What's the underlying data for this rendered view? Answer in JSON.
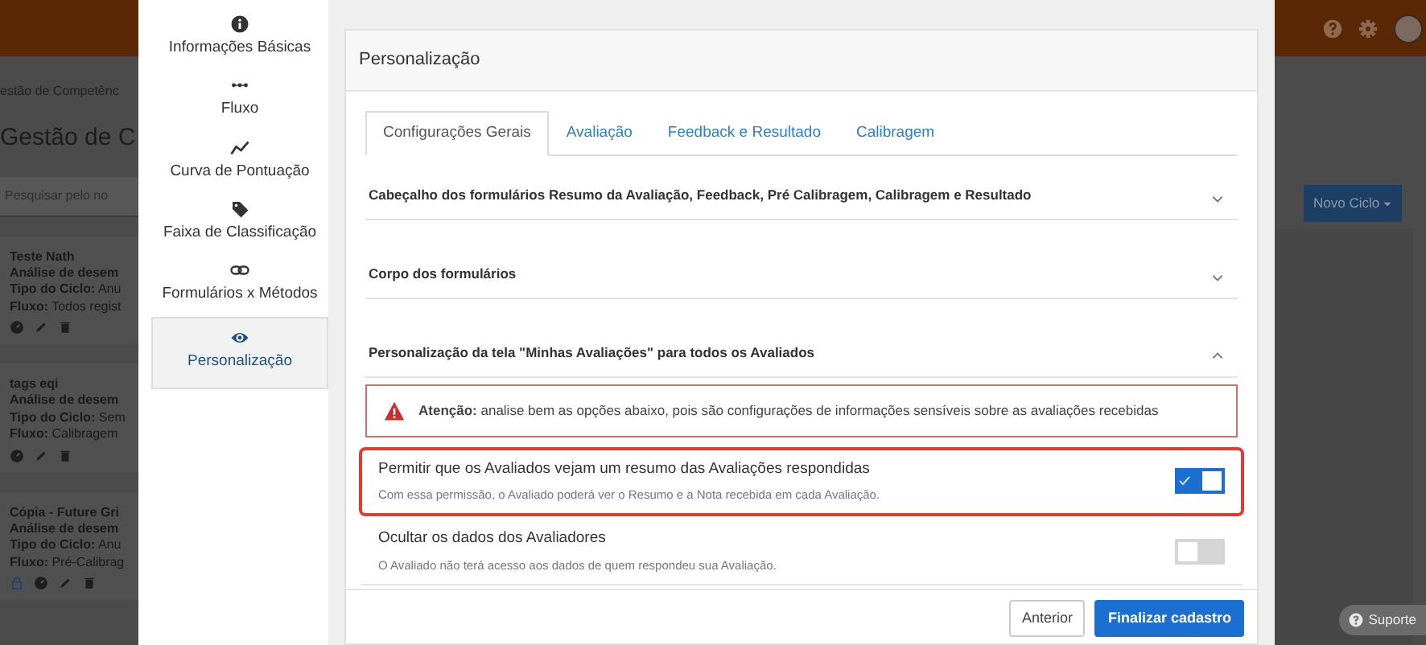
{
  "background_app": {
    "breadcrumb": "estão de Competênc",
    "title": "Gestão de C",
    "search": {
      "placeholder": "Pesquisar pelo no"
    },
    "cycles": [
      {
        "name": "Teste Nath",
        "subtitle": "Análise de desem",
        "type": "**Tipo do Ciclo:** Anu",
        "flow": "**Fluxo:** Todos regist",
        "locked": false
      },
      {
        "name": "tags eqi",
        "subtitle": "Análise de desem",
        "type": "**Tipo do Ciclo:** Sem",
        "flow": "**Fluxo:** Calibragem",
        "locked": false
      },
      {
        "name": "Cópia - Future Gri",
        "subtitle": "Análise de desem",
        "type": "**Tipo do Ciclo:** Anu",
        "flow": "**Fluxo:** Pré-Calibrag",
        "locked": true
      }
    ],
    "new_button": "Novo Ciclo",
    "support_button": "Suporte"
  },
  "modal": {
    "steps": [
      {
        "label": "Informações Básicas",
        "selected": false
      },
      {
        "label": "Fluxo",
        "selected": false
      },
      {
        "label": "Curva de Pontuação",
        "selected": false
      },
      {
        "label": "Faixa de Classificação",
        "selected": false
      },
      {
        "label": "Formulários x Métodos",
        "selected": false
      },
      {
        "label": "Personalização",
        "selected": true
      }
    ],
    "panel_title": "Personalização",
    "tabs": [
      {
        "label": "Configurações Gerais",
        "selected": true
      },
      {
        "label": "Avaliação",
        "selected": false
      },
      {
        "label": "Feedback e Resultado",
        "selected": false
      },
      {
        "label": "Calibragem",
        "selected": false
      }
    ],
    "sections": [
      {
        "title": "Cabeçalho dos formulários Resumo da Avaliação, Feedback, Pré Calibragem, Calibragem e Resultado",
        "expanded": false
      },
      {
        "title": "Corpo dos formulários",
        "expanded": false
      },
      {
        "title": "Personalização da tela \"Minhas Avaliações\" para todos os Avaliados",
        "expanded": true
      }
    ],
    "alert": "**Atenção:** analise bem as opções abaixo, pois são configurações de informações sensíveis sobre as avaliações recebidas",
    "options": [
      {
        "label": "Permitir que os Avaliados vejam um resumo das Avaliações respondidas",
        "description": "Com essa permissão, o Avaliado poderá ver o Resumo e a Nota recebida em cada Avaliação.",
        "on": true,
        "highlighted": true
      },
      {
        "label": "Ocultar os dados dos Avaliadores",
        "description": "O Avaliado não terá acesso aos dados de quem respondeu sua Avaliação.",
        "on": false,
        "highlighted": false
      }
    ],
    "buttons": [
      {
        "label": "Anterior",
        "kind": "secondary"
      },
      {
        "label": "Finalizar cadastro",
        "kind": "primary"
      }
    ]
  }
}
